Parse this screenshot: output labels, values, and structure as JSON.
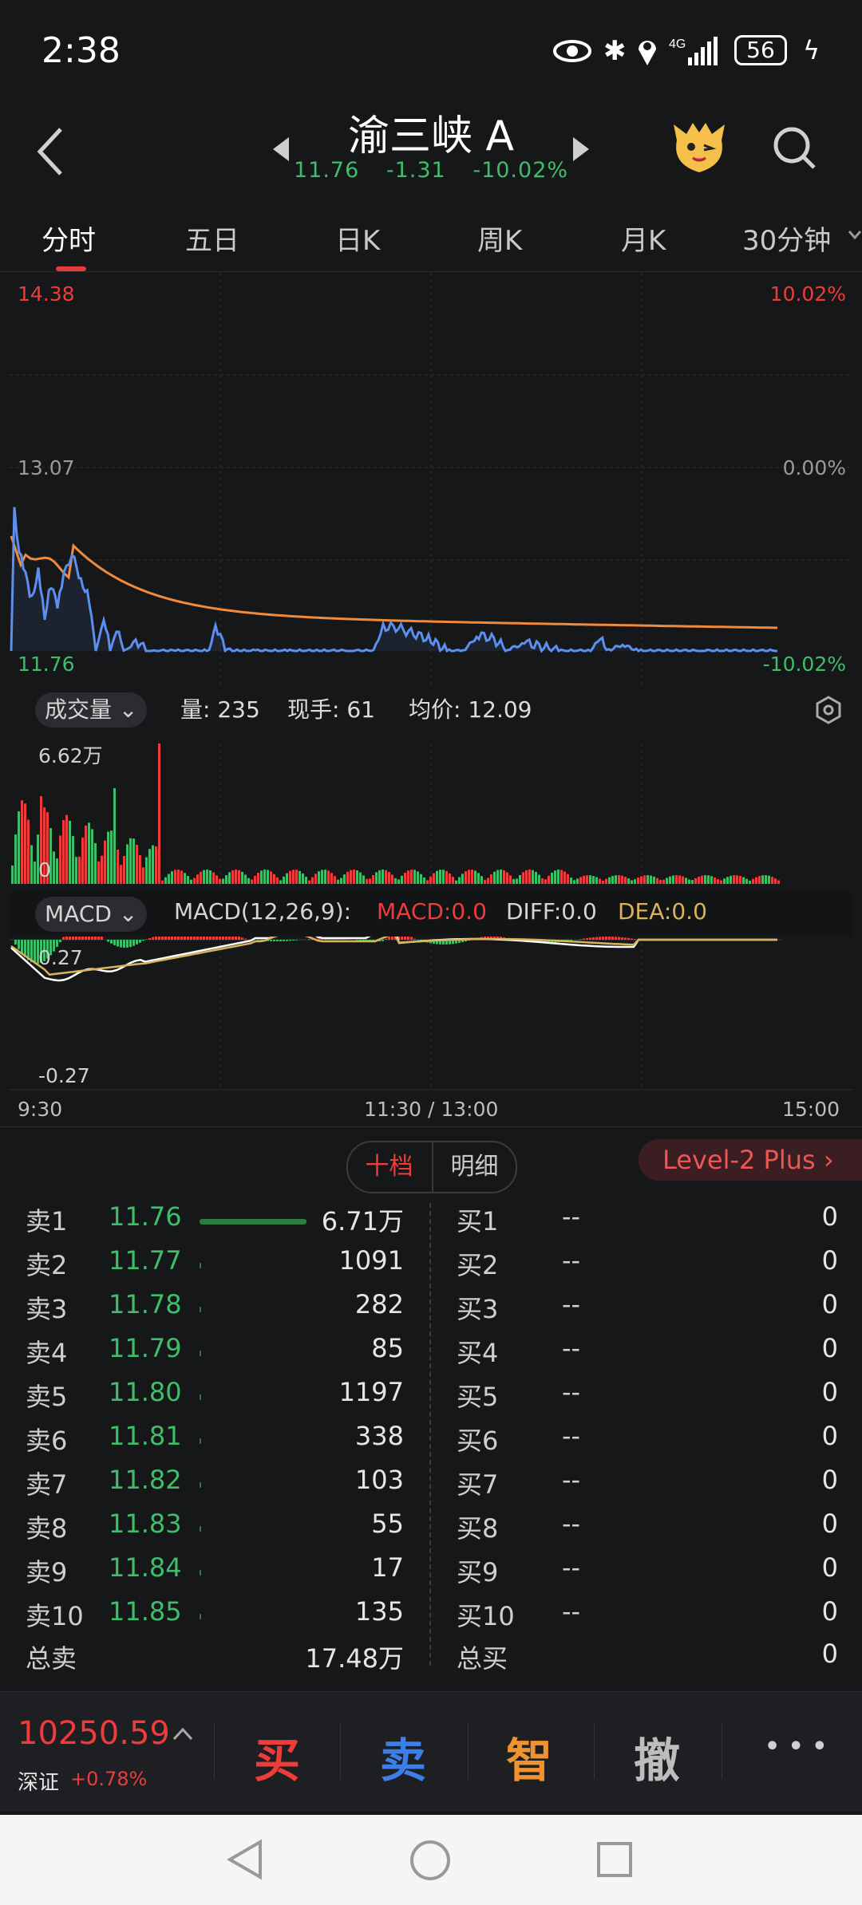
{
  "status": {
    "time": "2:38",
    "battery": "56"
  },
  "header": {
    "title": "渝三峡 A",
    "price": "11.76",
    "change": "-1.31",
    "pct": "-10.02%"
  },
  "tabs": [
    "分时",
    "五日",
    "日K",
    "周K",
    "月K",
    "30分钟"
  ],
  "intraday": {
    "price_high": "14.38",
    "price_mid": "13.07",
    "price_low": "11.76",
    "pct_high": "10.02%",
    "pct_mid": "0.00%",
    "pct_low": "-10.02%"
  },
  "volume_bar": {
    "selector": "成交量",
    "vol": "量: 235",
    "hand": "现手: 61",
    "avg": "均价: 12.09",
    "axis_max": "6.62万",
    "axis_zero": "0"
  },
  "macd_bar": {
    "selector": "MACD",
    "params": "MACD(12,26,9):",
    "macd": "MACD:0.0",
    "diff": "DIFF:0.0",
    "dea": "DEA:0.0",
    "axis_top": "0.27",
    "axis_bottom": "-0.27"
  },
  "time_axis": {
    "start": "9:30",
    "mid": "11:30 / 13:00",
    "end": "15:00"
  },
  "order_book": {
    "tab_depth": "十档",
    "tab_detail": "明细",
    "level2": "Level-2 Plus",
    "asks": [
      {
        "label": "卖1",
        "price": "11.76",
        "vol": "6.71万",
        "fill": 1.0
      },
      {
        "label": "卖2",
        "price": "11.77",
        "vol": "1091",
        "fill": 0.016
      },
      {
        "label": "卖3",
        "price": "11.78",
        "vol": "282",
        "fill": 0.004
      },
      {
        "label": "卖4",
        "price": "11.79",
        "vol": "85",
        "fill": 0.001
      },
      {
        "label": "卖5",
        "price": "11.80",
        "vol": "1197",
        "fill": 0.018
      },
      {
        "label": "卖6",
        "price": "11.81",
        "vol": "338",
        "fill": 0.005
      },
      {
        "label": "卖7",
        "price": "11.82",
        "vol": "103",
        "fill": 0.0015
      },
      {
        "label": "卖8",
        "price": "11.83",
        "vol": "55",
        "fill": 0.001
      },
      {
        "label": "卖9",
        "price": "11.84",
        "vol": "17",
        "fill": 0.0
      },
      {
        "label": "卖10",
        "price": "11.85",
        "vol": "135",
        "fill": 0.002
      }
    ],
    "bids": [
      {
        "label": "买1",
        "price": "--",
        "vol": "0"
      },
      {
        "label": "买2",
        "price": "--",
        "vol": "0"
      },
      {
        "label": "买3",
        "price": "--",
        "vol": "0"
      },
      {
        "label": "买4",
        "price": "--",
        "vol": "0"
      },
      {
        "label": "买5",
        "price": "--",
        "vol": "0"
      },
      {
        "label": "买6",
        "price": "--",
        "vol": "0"
      },
      {
        "label": "买7",
        "price": "--",
        "vol": "0"
      },
      {
        "label": "买8",
        "price": "--",
        "vol": "0"
      },
      {
        "label": "买9",
        "price": "--",
        "vol": "0"
      },
      {
        "label": "买10",
        "price": "--",
        "vol": "0"
      }
    ],
    "total_sell_label": "总卖",
    "total_sell": "17.48万",
    "total_buy_label": "总买",
    "total_buy": "0"
  },
  "bottom": {
    "index_value": "10250.59",
    "index_name": "深证",
    "index_pct": "+0.78%",
    "buy": "买",
    "sell": "卖",
    "smart": "智",
    "cancel": "撤",
    "more": "• • •"
  },
  "colors": {
    "up": "#ee3b3b",
    "down": "#3ebd6a",
    "price_line": "#5b8ff0",
    "avg_line": "#f08a3c",
    "dea": "#d9b25a"
  }
}
